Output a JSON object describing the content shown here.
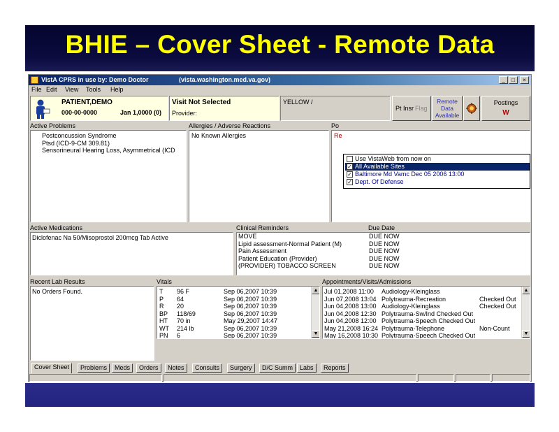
{
  "slide": {
    "title": "BHIE – Cover Sheet - Remote Data"
  },
  "window": {
    "title": "VistA CPRS in use by: Demo Doctor",
    "url": "(vista.washington.med.va.gov)",
    "controls": {
      "minimize": "_",
      "maximize": "□",
      "close": "×"
    }
  },
  "menu": [
    "File",
    "Edit",
    "View",
    "Tools",
    "Help"
  ],
  "patient": {
    "name": "PATIENT,DEMO",
    "ssn": "000-00-0000",
    "dob": "Jan 1,0000 (0)"
  },
  "visit": {
    "title": "Visit Not Selected",
    "provider_label": "Provider:"
  },
  "status_box": {
    "text": "YELLOW /"
  },
  "toolbar": {
    "pt_insurance": "Pt Insr",
    "flag": "Flag",
    "remote_data": [
      "Remote",
      "Data",
      "Available"
    ],
    "postings_label": "Postings",
    "postings_value": "W"
  },
  "active_problems": {
    "label": "Active Problems",
    "items": [
      "Postconcussion Syndrome",
      "Ptsd (ICD-9-CM 309.81)",
      "Sensorineural Hearing Loss, Asymmetrical (ICD"
    ]
  },
  "allergies": {
    "label": "Allergies / Adverse Reactions",
    "items": [
      "No Known Allergies"
    ]
  },
  "postings_panel": {
    "label": "Po",
    "first": "Re"
  },
  "remote_popup": {
    "items": [
      {
        "label": "Use VistaWeb from now on",
        "checked": false,
        "selected": false
      },
      {
        "label": "All Available Sites",
        "checked": true,
        "selected": true
      },
      {
        "label": "Baltimore Md Vamc Dec 05 2006 13:00",
        "checked": true,
        "selected": false
      },
      {
        "label": "Dept. Of Defense",
        "checked": true,
        "selected": false
      }
    ]
  },
  "active_medications": {
    "label": "Active Medications",
    "items": [
      "Diclofenac Na 50/Misoprostol 200mcg Tab Active"
    ]
  },
  "clinical_reminders": {
    "label": "Clinical Reminders",
    "due_label": "Due Date",
    "items": [
      {
        "name": "MOVE",
        "due": "DUE NOW"
      },
      {
        "name": "Lipid assessment-Normal Patient (M)",
        "due": "DUE NOW"
      },
      {
        "name": "Pain Assessment",
        "due": "DUE NOW"
      },
      {
        "name": "Patient Education (Provider)",
        "due": "DUE NOW"
      },
      {
        "name": "(PROVIDER) TOBACCO SCREEN",
        "due": "DUE NOW"
      }
    ]
  },
  "lab_results": {
    "label": "Recent Lab Results",
    "items": [
      "No Orders Found."
    ]
  },
  "vitals": {
    "label": "Vitals",
    "items": [
      {
        "code": "T",
        "value": "96 F",
        "date": "Sep 06,2007 10:39"
      },
      {
        "code": "P",
        "value": "64",
        "date": "Sep 06,2007 10:39"
      },
      {
        "code": "R",
        "value": "20",
        "date": "Sep 06,2007 10:39"
      },
      {
        "code": "BP",
        "value": "118/69",
        "date": "Sep 06,2007 10:39"
      },
      {
        "code": "HT",
        "value": "70 in",
        "date": "May 29,2007 14:47"
      },
      {
        "code": "WT",
        "value": "214 lb",
        "date": "Sep 06,2007 10:39"
      },
      {
        "code": "PN",
        "value": "6",
        "date": "Sep 06,2007 10:39"
      }
    ]
  },
  "appointments": {
    "label": "Appointments/Visits/Admissions",
    "items": [
      {
        "date": "Jul 01,2008 11:00",
        "clinic": "Audiology-Kleinglass",
        "status": ""
      },
      {
        "date": "Jun 07,2008 13:04",
        "clinic": "Polytrauma-Recreation",
        "status": "Checked Out"
      },
      {
        "date": "Jun 04,2008 13:00",
        "clinic": "Audiology-Kleinglass",
        "status": "Checked Out"
      },
      {
        "date": "Jun 04,2008 12:30",
        "clinic": "Polytrauma-Sw/Ind  Checked Out",
        "status": ""
      },
      {
        "date": "Jun 04,2008 12:00",
        "clinic": "Polytrauma-Speech Checked Out",
        "status": ""
      },
      {
        "date": "May 21,2008 16:24",
        "clinic": "Polytrauma-Telephone",
        "status": "Non-Count"
      },
      {
        "date": "May 16,2008 10:30",
        "clinic": "Polytrauma-Speech Checked Out",
        "status": ""
      }
    ]
  },
  "tabs": [
    "Cover Sheet",
    "Problems",
    "Meds",
    "Orders",
    "Notes",
    "Consults",
    "Surgery",
    "D/C Summ",
    "Labs",
    "Reports"
  ],
  "scroll_arrows": {
    "up": "▲",
    "down": "▼"
  },
  "colors": {
    "banner": "#0b0b3f",
    "title": "#ffff00",
    "footer": "#232380",
    "window_face": "#d4d0c8",
    "selection": "#0a246a"
  }
}
